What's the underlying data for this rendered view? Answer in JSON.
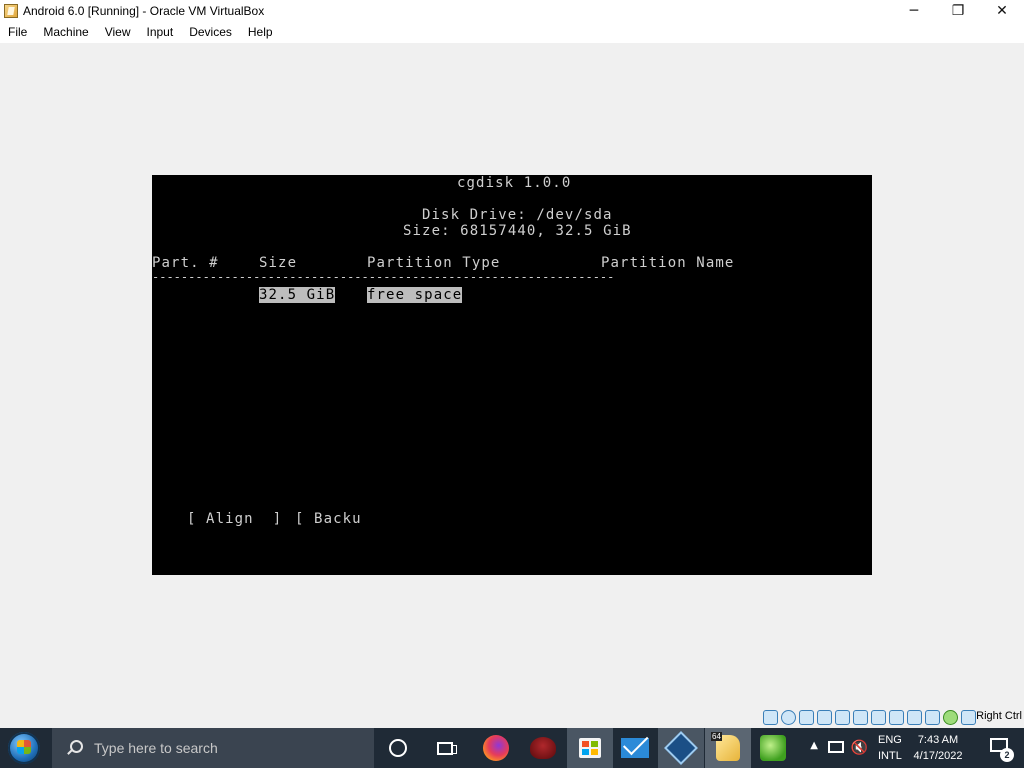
{
  "window": {
    "title": "Android 6.0 [Running] - Oracle VM VirtualBox",
    "controls": {
      "minimize": "─",
      "restore": "❐",
      "close": "✕"
    }
  },
  "menu": [
    "File",
    "Machine",
    "View",
    "Input",
    "Devices",
    "Help"
  ],
  "terminal": {
    "app_title": "cgdisk 1.0.0",
    "drive_line": "Disk Drive: /dev/sda",
    "size_line": "Size: 68157440, 32.5 GiB",
    "columns": {
      "part": "Part. #",
      "size": "Size",
      "type": "Partition Type",
      "name": "Partition Name"
    },
    "separator": "----------------------------------------------------------------",
    "row": {
      "size": "32.5 GiB",
      "type": "free space"
    },
    "actions": {
      "align": "[ Align  ]",
      "backup": "[ Backu"
    }
  },
  "statusbar": {
    "host_key": "Right Ctrl",
    "icons": [
      "hard-disk-icon",
      "optical-disk-icon",
      "audio-icon",
      "network-icon",
      "usb-icon",
      "shared-folders-icon",
      "display-icon",
      "video-capture-icon",
      "vm-settings-icon",
      "cpu-icon",
      "green-status-icon",
      "mouse-integration-icon"
    ]
  },
  "taskbar": {
    "search_placeholder": "Type here to search",
    "apps": [
      "cortana-icon",
      "task-view-icon",
      "firefox-icon",
      "red-app-icon",
      "store-icon",
      "mail-icon",
      "virtualbox-icon",
      "virtualbox-vm-icon",
      "green-app-icon"
    ],
    "vm_badge": "64",
    "language": {
      "line1": "ENG",
      "line2": "INTL"
    },
    "clock": {
      "time": "7:43 AM",
      "date": "4/17/2022"
    },
    "notification_count": "2"
  },
  "colors": {
    "taskbar_bg": "#1f2a36",
    "vm_screen_bg": "#000000",
    "terminal_text": "#cfcfcf",
    "highlight": "#bdbdbd"
  }
}
